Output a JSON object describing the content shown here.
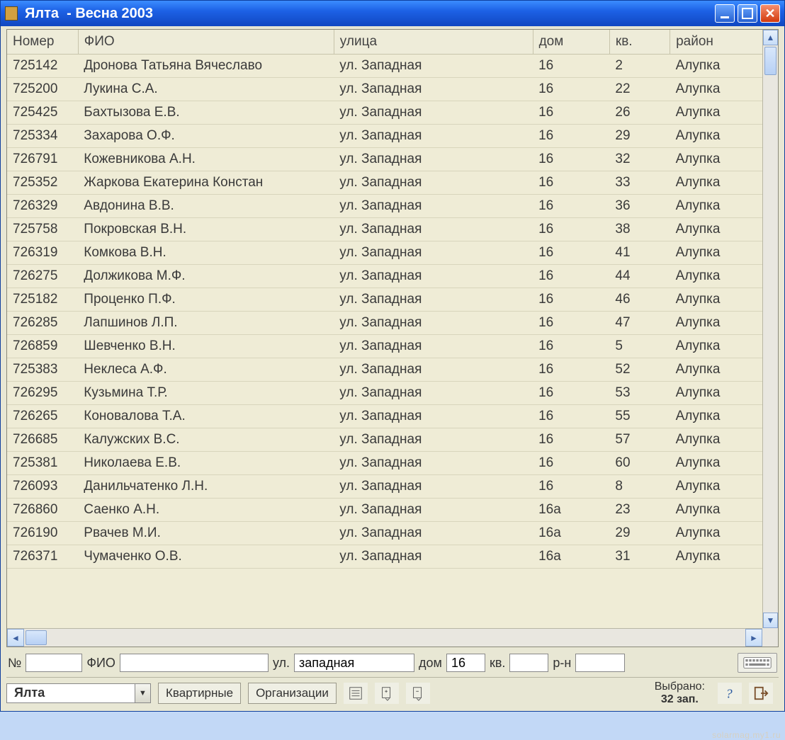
{
  "window": {
    "title": "Ялта  - Весна 2003"
  },
  "columns": {
    "number": "Номер",
    "fio": "ФИО",
    "street": "улица",
    "house": "дом",
    "apt": "кв.",
    "district": "район"
  },
  "rows": [
    {
      "num": "725142",
      "fio": "Дронова Татьяна Вячеславо",
      "street": "ул. Западная",
      "house": "16",
      "apt": "2",
      "district": "Алупка"
    },
    {
      "num": "725200",
      "fio": "Лукина С.А.",
      "street": "ул. Западная",
      "house": "16",
      "apt": "22",
      "district": "Алупка"
    },
    {
      "num": "725425",
      "fio": "Бахтызова Е.В.",
      "street": "ул. Западная",
      "house": "16",
      "apt": "26",
      "district": "Алупка"
    },
    {
      "num": "725334",
      "fio": "Захарова О.Ф.",
      "street": "ул. Западная",
      "house": "16",
      "apt": "29",
      "district": "Алупка"
    },
    {
      "num": "726791",
      "fio": "Кожевникова А.Н.",
      "street": "ул. Западная",
      "house": "16",
      "apt": "32",
      "district": "Алупка"
    },
    {
      "num": "725352",
      "fio": "Жаркова Екатерина Констан",
      "street": "ул. Западная",
      "house": "16",
      "apt": "33",
      "district": "Алупка"
    },
    {
      "num": "726329",
      "fio": "Авдонина В.В.",
      "street": "ул. Западная",
      "house": "16",
      "apt": "36",
      "district": "Алупка"
    },
    {
      "num": "725758",
      "fio": "Покровская В.Н.",
      "street": "ул. Западная",
      "house": "16",
      "apt": "38",
      "district": "Алупка"
    },
    {
      "num": "726319",
      "fio": "Комкова В.Н.",
      "street": "ул. Западная",
      "house": "16",
      "apt": "41",
      "district": "Алупка"
    },
    {
      "num": "726275",
      "fio": "Должикова М.Ф.",
      "street": "ул. Западная",
      "house": "16",
      "apt": "44",
      "district": "Алупка"
    },
    {
      "num": "725182",
      "fio": "Проценко П.Ф.",
      "street": "ул. Западная",
      "house": "16",
      "apt": "46",
      "district": "Алупка"
    },
    {
      "num": "726285",
      "fio": "Лапшинов Л.П.",
      "street": "ул. Западная",
      "house": "16",
      "apt": "47",
      "district": "Алупка"
    },
    {
      "num": "726859",
      "fio": "Шевченко В.Н.",
      "street": "ул. Западная",
      "house": "16",
      "apt": "5",
      "district": "Алупка"
    },
    {
      "num": "725383",
      "fio": "Неклеса А.Ф.",
      "street": "ул. Западная",
      "house": "16",
      "apt": "52",
      "district": "Алупка"
    },
    {
      "num": "726295",
      "fio": "Кузьмина Т.Р.",
      "street": "ул. Западная",
      "house": "16",
      "apt": "53",
      "district": "Алупка"
    },
    {
      "num": "726265",
      "fio": "Коновалова Т.А.",
      "street": "ул. Западная",
      "house": "16",
      "apt": "55",
      "district": "Алупка"
    },
    {
      "num": "726685",
      "fio": "Калужских В.С.",
      "street": "ул. Западная",
      "house": "16",
      "apt": "57",
      "district": "Алупка"
    },
    {
      "num": "725381",
      "fio": "Николаева Е.В.",
      "street": "ул. Западная",
      "house": "16",
      "apt": "60",
      "district": "Алупка"
    },
    {
      "num": "726093",
      "fio": "Данильчатенко Л.Н.",
      "street": "ул. Западная",
      "house": "16",
      "apt": "8",
      "district": "Алупка"
    },
    {
      "num": "726860",
      "fio": "Саенко А.Н.",
      "street": "ул. Западная",
      "house": "16а",
      "apt": "23",
      "district": "Алупка"
    },
    {
      "num": "726190",
      "fio": "Рвачев М.И.",
      "street": "ул. Западная",
      "house": "16а",
      "apt": "29",
      "district": "Алупка"
    },
    {
      "num": "726371",
      "fio": "Чумаченко О.В.",
      "street": "ул. Западная",
      "house": "16а",
      "apt": "31",
      "district": "Алупка"
    }
  ],
  "search": {
    "num_label": "№",
    "num_value": "",
    "fio_label": "ФИО",
    "fio_value": "",
    "street_label": "ул.",
    "street_value": "западная",
    "house_label": "дом",
    "house_value": "16",
    "apt_label": "кв.",
    "apt_value": "",
    "district_label": "р-н",
    "district_value": ""
  },
  "bottom": {
    "city_value": "Ялта",
    "btn_kvartirnye": "Квартирные",
    "btn_organizacii": "Организации",
    "selected_label": "Выбрано:",
    "selected_count": "32 зап."
  },
  "watermark": "solarmag.my1.ru"
}
